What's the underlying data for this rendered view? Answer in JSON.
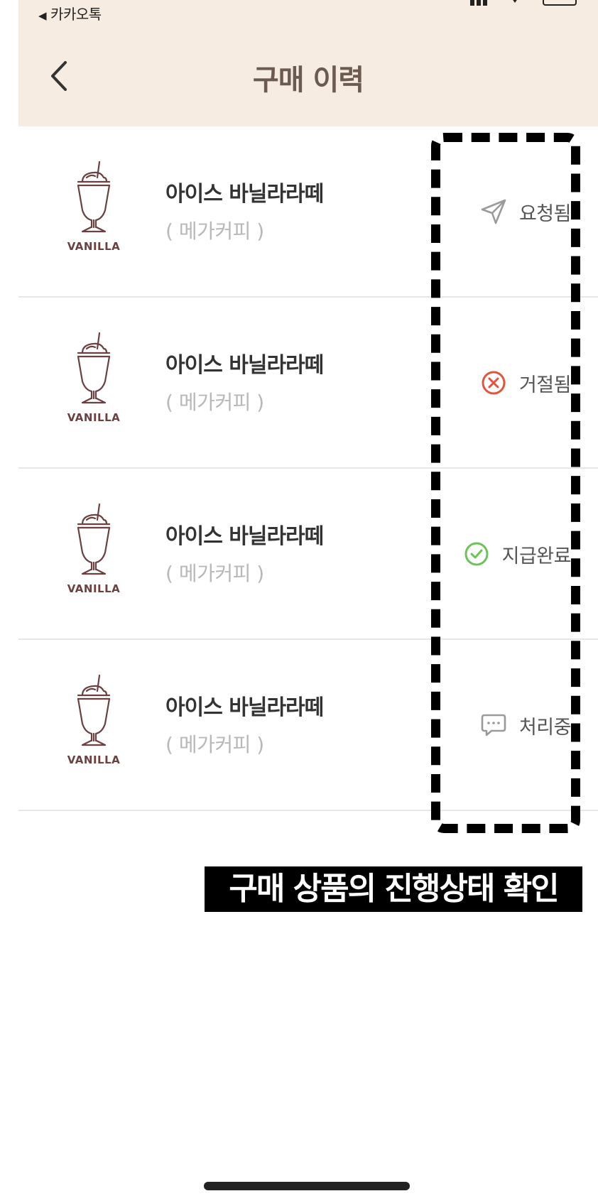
{
  "status_bar": {
    "back_app": "카카오톡"
  },
  "header": {
    "title": "구매 이력"
  },
  "items": [
    {
      "thumb_label": "VANILLA",
      "name": "아이스 바닐라라떼",
      "brand": "( 메가커피 )",
      "status": "요청됨",
      "status_icon": "send-icon",
      "status_color": "#9a9a9a"
    },
    {
      "thumb_label": "VANILLA",
      "name": "아이스 바닐라라떼",
      "brand": "( 메가커피 )",
      "status": "거절됨",
      "status_icon": "reject-icon",
      "status_color": "#e2543d"
    },
    {
      "thumb_label": "VANILLA",
      "name": "아이스 바닐라라떼",
      "brand": "( 메가커피 )",
      "status": "지급완료",
      "status_icon": "check-icon",
      "status_color": "#6cc35a"
    },
    {
      "thumb_label": "VANILLA",
      "name": "아이스 바닐라라떼",
      "brand": "( 메가커피 )",
      "status": "처리중",
      "status_icon": "chat-bubble-icon",
      "status_color": "#9a9a9a"
    }
  ],
  "caption": "구매 상품의 진행상태 확인",
  "colors": {
    "header_bg": "#f6ece1",
    "title": "#6b5a50",
    "thumb_stroke": "#6b4040"
  }
}
